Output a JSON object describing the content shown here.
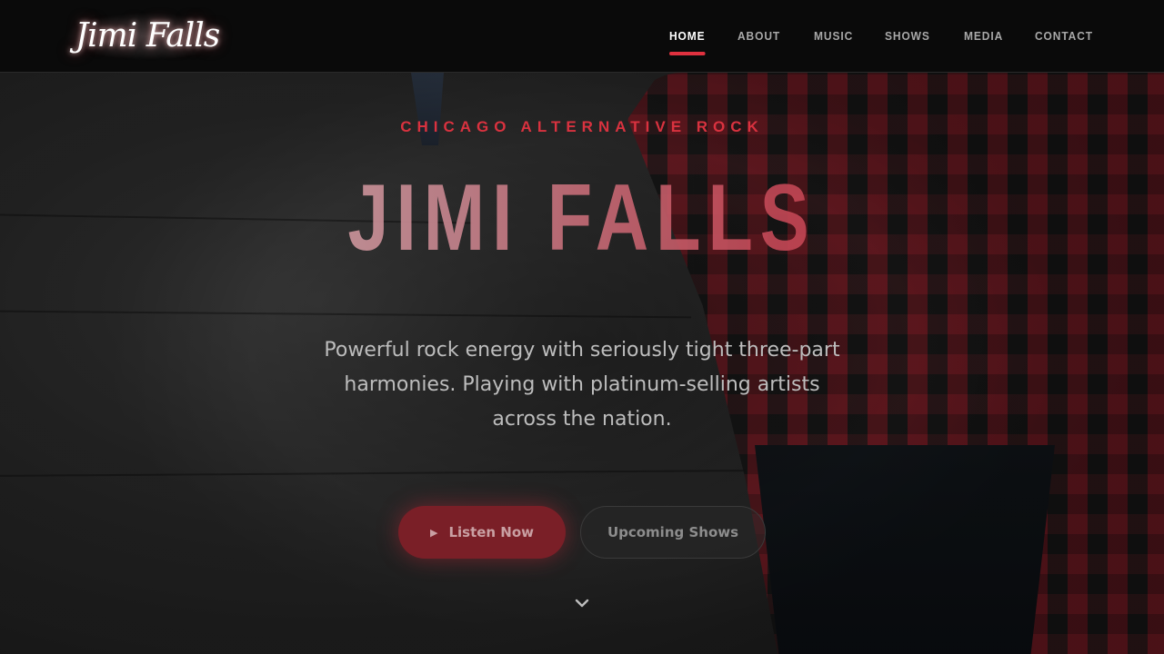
{
  "brand": {
    "logo_text": "Jimi Falls"
  },
  "nav": {
    "items": [
      {
        "label": "HOME",
        "active": true
      },
      {
        "label": "ABOUT",
        "active": false
      },
      {
        "label": "MUSIC",
        "active": false
      },
      {
        "label": "SHOWS",
        "active": false
      },
      {
        "label": "MEDIA",
        "active": false
      },
      {
        "label": "CONTACT",
        "active": false
      }
    ]
  },
  "hero": {
    "eyebrow": "CHICAGO ALTERNATIVE ROCK",
    "title": "JIMI FALLS",
    "subtitle": "Powerful rock energy with seriously tight three-part harmonies. Playing with platinum-selling artists across the nation.",
    "primary_button": {
      "label": "Listen Now",
      "icon": "play-icon"
    },
    "secondary_button": {
      "label": "Upcoming Shows"
    },
    "scroll_icon": "chevron-down-icon"
  },
  "colors": {
    "accent": "#e0313f",
    "header_bg": "#0a0a0a",
    "nav_text": "#a8a8a8",
    "nav_active": "#ffffff"
  }
}
